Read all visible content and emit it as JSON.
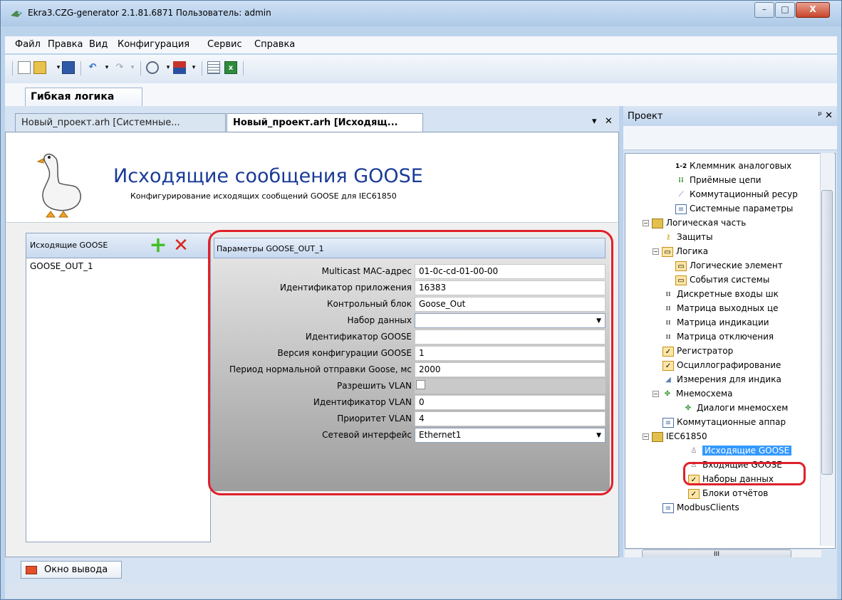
{
  "window": {
    "title": "Ekra3.CZG-generator 2.1.81.6871 Пользователь: admin",
    "controls": [
      "–",
      "□",
      "X"
    ]
  },
  "menu": [
    "Файл",
    "Правка",
    "Вид",
    "Конфигурация",
    "Сервис",
    "Справка"
  ],
  "toolbar": {
    "icons": [
      "new-file-icon",
      "open-folder-icon",
      "save-icon",
      "undo-icon",
      "redo-icon",
      "timer-icon",
      "flag-icon",
      "list-icon",
      "excel-icon"
    ]
  },
  "ribbon": {
    "tab": "Гибкая логика"
  },
  "doc_tabs": {
    "items": [
      "Новый_проект.arh [Системные...",
      "Новый_проект.arh [Исходящ..."
    ],
    "active": 1,
    "menu_glyph": "▾",
    "close_glyph": "✕"
  },
  "header": {
    "title": "Исходящие сообщения GOOSE",
    "subtitle": "Конфигурирование исходящих сообщений GOOSE для IEC61850"
  },
  "list_panel": {
    "title": "Исходящие GOOSE",
    "items": [
      "GOOSE_OUT_1"
    ]
  },
  "params": {
    "title": "Параметры GOOSE_OUT_1",
    "rows": [
      {
        "label": "Multicast MAC-адрес",
        "value": "01-0c-cd-01-00-00",
        "type": "text"
      },
      {
        "label": "Идентификатор приложения",
        "value": "16383",
        "type": "text"
      },
      {
        "label": "Контрольный блок",
        "value": "Goose_Out",
        "type": "text"
      },
      {
        "label": "Набор данных",
        "value": "",
        "type": "combo"
      },
      {
        "label": "Идентификатор GOOSE",
        "value": "",
        "type": "text"
      },
      {
        "label": "Версия конфигурации GOOSE",
        "value": "1",
        "type": "text"
      },
      {
        "label": "Период нормальной отправки Goose, мс",
        "value": "2000",
        "type": "text"
      },
      {
        "label": "Разрешить VLAN",
        "value": "",
        "type": "checkbox",
        "checked": false
      },
      {
        "label": "Идентификатор VLAN",
        "value": "0",
        "type": "text"
      },
      {
        "label": "Приоритет VLAN",
        "value": "4",
        "type": "text"
      },
      {
        "label": "Сетевой интерфейс",
        "value": "Ethernet1",
        "type": "combo"
      }
    ]
  },
  "project": {
    "title": "Проект",
    "pin_glyph": "ᵖ",
    "close_glyph": "✕",
    "tree": [
      {
        "label": "Клеммник аналоговых",
        "prefix": "1-2",
        "icon": "terminal-icon",
        "level": 3
      },
      {
        "label": "Приёмные цепи",
        "icon": "circuit-icon",
        "level": 3
      },
      {
        "label": "Коммутационный ресур",
        "icon": "switching-icon",
        "level": 3
      },
      {
        "label": "Системные параметры",
        "icon": "document-icon",
        "level": 3
      },
      {
        "label": "Логическая часть",
        "icon": "folder-icon",
        "level": 1,
        "expander": "−"
      },
      {
        "label": "Защиты",
        "icon": "key-icon",
        "level": 2
      },
      {
        "label": "Логика",
        "icon": "logic-icon",
        "level": 2,
        "expander": "−"
      },
      {
        "label": "Логические элемент",
        "icon": "logic-icon",
        "level": 3
      },
      {
        "label": "События системы",
        "icon": "logic-icon",
        "level": 3
      },
      {
        "label": "Дискретные входы шк",
        "icon": "matrix-icon",
        "level": 2
      },
      {
        "label": "Матрица выходных це",
        "icon": "matrix-icon",
        "level": 2
      },
      {
        "label": "Матрица индикации",
        "icon": "matrix-icon",
        "level": 2
      },
      {
        "label": "Матрица отключения",
        "icon": "matrix-icon",
        "level": 2
      },
      {
        "label": "Регистратор",
        "icon": "chart-icon",
        "level": 2
      },
      {
        "label": "Осциллографирование",
        "icon": "chart-icon",
        "level": 2
      },
      {
        "label": "Измерения для индика",
        "icon": "measurement-icon",
        "level": 2
      },
      {
        "label": "Мнемосхема",
        "icon": "diagram-icon",
        "level": 2,
        "expander": "−"
      },
      {
        "label": "Диалоги мнемосхем",
        "icon": "diagram-icon",
        "level": 3
      },
      {
        "label": "Коммутационные аппар",
        "icon": "document-icon",
        "level": 2
      },
      {
        "label": "IEC61850",
        "icon": "folder-icon",
        "level": 1,
        "expander": "−"
      },
      {
        "label": "Исходящие GOOSE",
        "icon": "goose-icon",
        "level": 2,
        "selected": true
      },
      {
        "label": "Входящие GOOSE",
        "icon": "goose-icon",
        "level": 2
      },
      {
        "label": "Наборы данных",
        "icon": "chart-icon",
        "level": 2
      },
      {
        "label": "Блоки отчётов",
        "icon": "chart-icon",
        "level": 2
      },
      {
        "label": "ModbusClients",
        "icon": "document-icon",
        "level": 1
      }
    ],
    "hscroll_glyph": "III"
  },
  "output": {
    "tab": "Окно вывода"
  },
  "colors": {
    "accent_red": "#e0202a",
    "title_blue": "#1a3b96",
    "selection": "#3399ff"
  }
}
